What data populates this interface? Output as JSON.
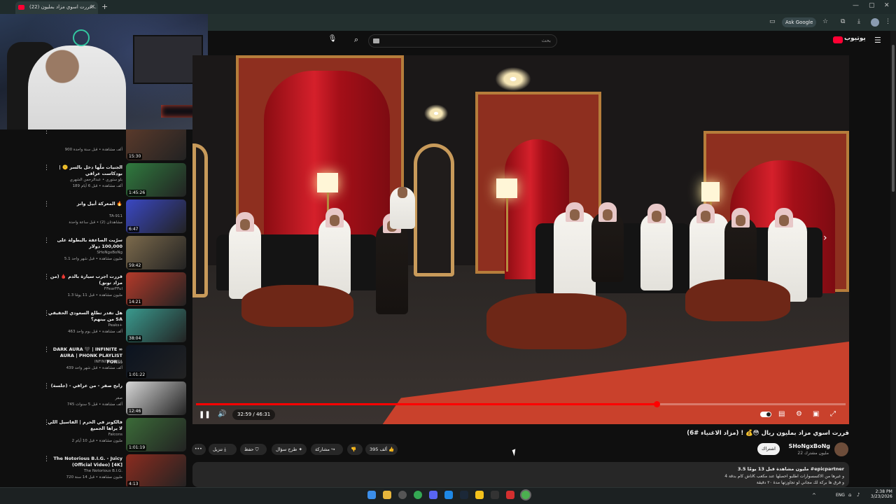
{
  "browser": {
    "tab_title": "(22) قررت اسوي مزاد بمليون...",
    "new_tab": "+",
    "ask_google": "Ask Google"
  },
  "youtube": {
    "search_placeholder": "بحث",
    "logo_text": "يوتيوب"
  },
  "sidebar": {
    "items": [
      {
        "title": "",
        "channel": "",
        "meta": "900 ألف مشاهدة • قبل سنة واحدة",
        "duration": "15:30",
        "thumb": "#5b3a2b"
      },
      {
        "title": "الجنيات ملّها دخل بالسر 🤫 | بودكاست عراقي",
        "channel": "بلو ستوري • عبدالرحمن الشهري",
        "meta": "189 ألف مشاهدة • قبل 6 أيام",
        "duration": "1:45:26",
        "thumb": "#2f7a3e"
      },
      {
        "title": "المعركة أبيل وانز 🔥",
        "channel": "TA-911",
        "meta": "مشاهدتان (2) • قبل ساعة واحدة",
        "duration": "6:47",
        "thumb": "#3a48c4"
      },
      {
        "title": "سرّيت الصاعقة بالبطولة على 100,000 دولار",
        "channel": "SHoNgxBoNg",
        "meta": "5.1 مليون مشاهدة • قبل شهر واحد",
        "duration": "59:42",
        "thumb": "#7c6a4c"
      },
      {
        "title": "قررت اجرب سيارة بالدم 🩸 (من مزاد تونق)",
        "channel": "FFearFFul",
        "meta": "1.3 مليون مشاهدة • قبل 11 يومًا",
        "duration": "14:21",
        "thumb": "#b33a2a"
      },
      {
        "title": "هل تقدر تطلع السعودي الحقيقي من بينهم؟ SA",
        "channel": "Peaks+",
        "meta": "463 ألف مشاهدة • قبل يوم واحد",
        "duration": "38:04",
        "thumb": "#3a9a8e"
      },
      {
        "title": "DARK AURA 🖤 | INFINITE ∞ AURA | PHONK PLAYLIST FOR...",
        "channel": "INFINITE AURA",
        "meta": "439 ألف مشاهدة • قبل شهر واحد",
        "duration": "1:01:22",
        "thumb": "#0b1320"
      },
      {
        "title": "رابح صقر - من عراقي - (جلسة)",
        "channel": "صقر",
        "meta": "745 ألف مشاهدة • قبل 5 سنوات",
        "duration": "12:46",
        "thumb": "#d6d6d6"
      },
      {
        "title": "فالكونز في الحرم | الفاسيل اللي لا يراها الجميع",
        "channel": "Falcons",
        "meta": "2 مليون مشاهدة • قبل 10 أيام",
        "duration": "1:01:19",
        "thumb": "#3b6b38"
      },
      {
        "title": "The Notorious B.I.G. - Juicy (Official Video) [4K]",
        "channel": "The Notorious B.I.G.",
        "meta": "720 مليون مشاهدة • قبل 14 سنة",
        "duration": "4:13",
        "thumb": "#8b2c1f"
      }
    ]
  },
  "player": {
    "time": "32:59 / 46:31",
    "progress": 0.709
  },
  "video": {
    "title": "قررت اسوي مزاد بمليون ريال 😳💰 ! (مزاد الاغنياء #6)",
    "channel": "SHoNgxBoNg",
    "subscribers": "22 مليون مشترك",
    "subscribe": "اشتراك",
    "likes": "395 ألف",
    "share": "مشاركة",
    "remix": "طرح سؤال",
    "save": "حفظ",
    "download": "تنزيل",
    "more": "•••",
    "desc_stats": "3.5 مليون مشاهدة قبل 13 يومًا #epicpartner",
    "desc_line1": "ناش كام بدقة 4K و غيرها من الاكسسوارات اطلبو احصلها عند مكعب",
    "desc_line2": "و فرق ها بركة لك مجاني لو تجاوزتها مدة ٢٠ دقيقة"
  },
  "taskbar": {
    "lang": "ENG",
    "time": "2:38 PM",
    "date": "3/23/2026"
  }
}
